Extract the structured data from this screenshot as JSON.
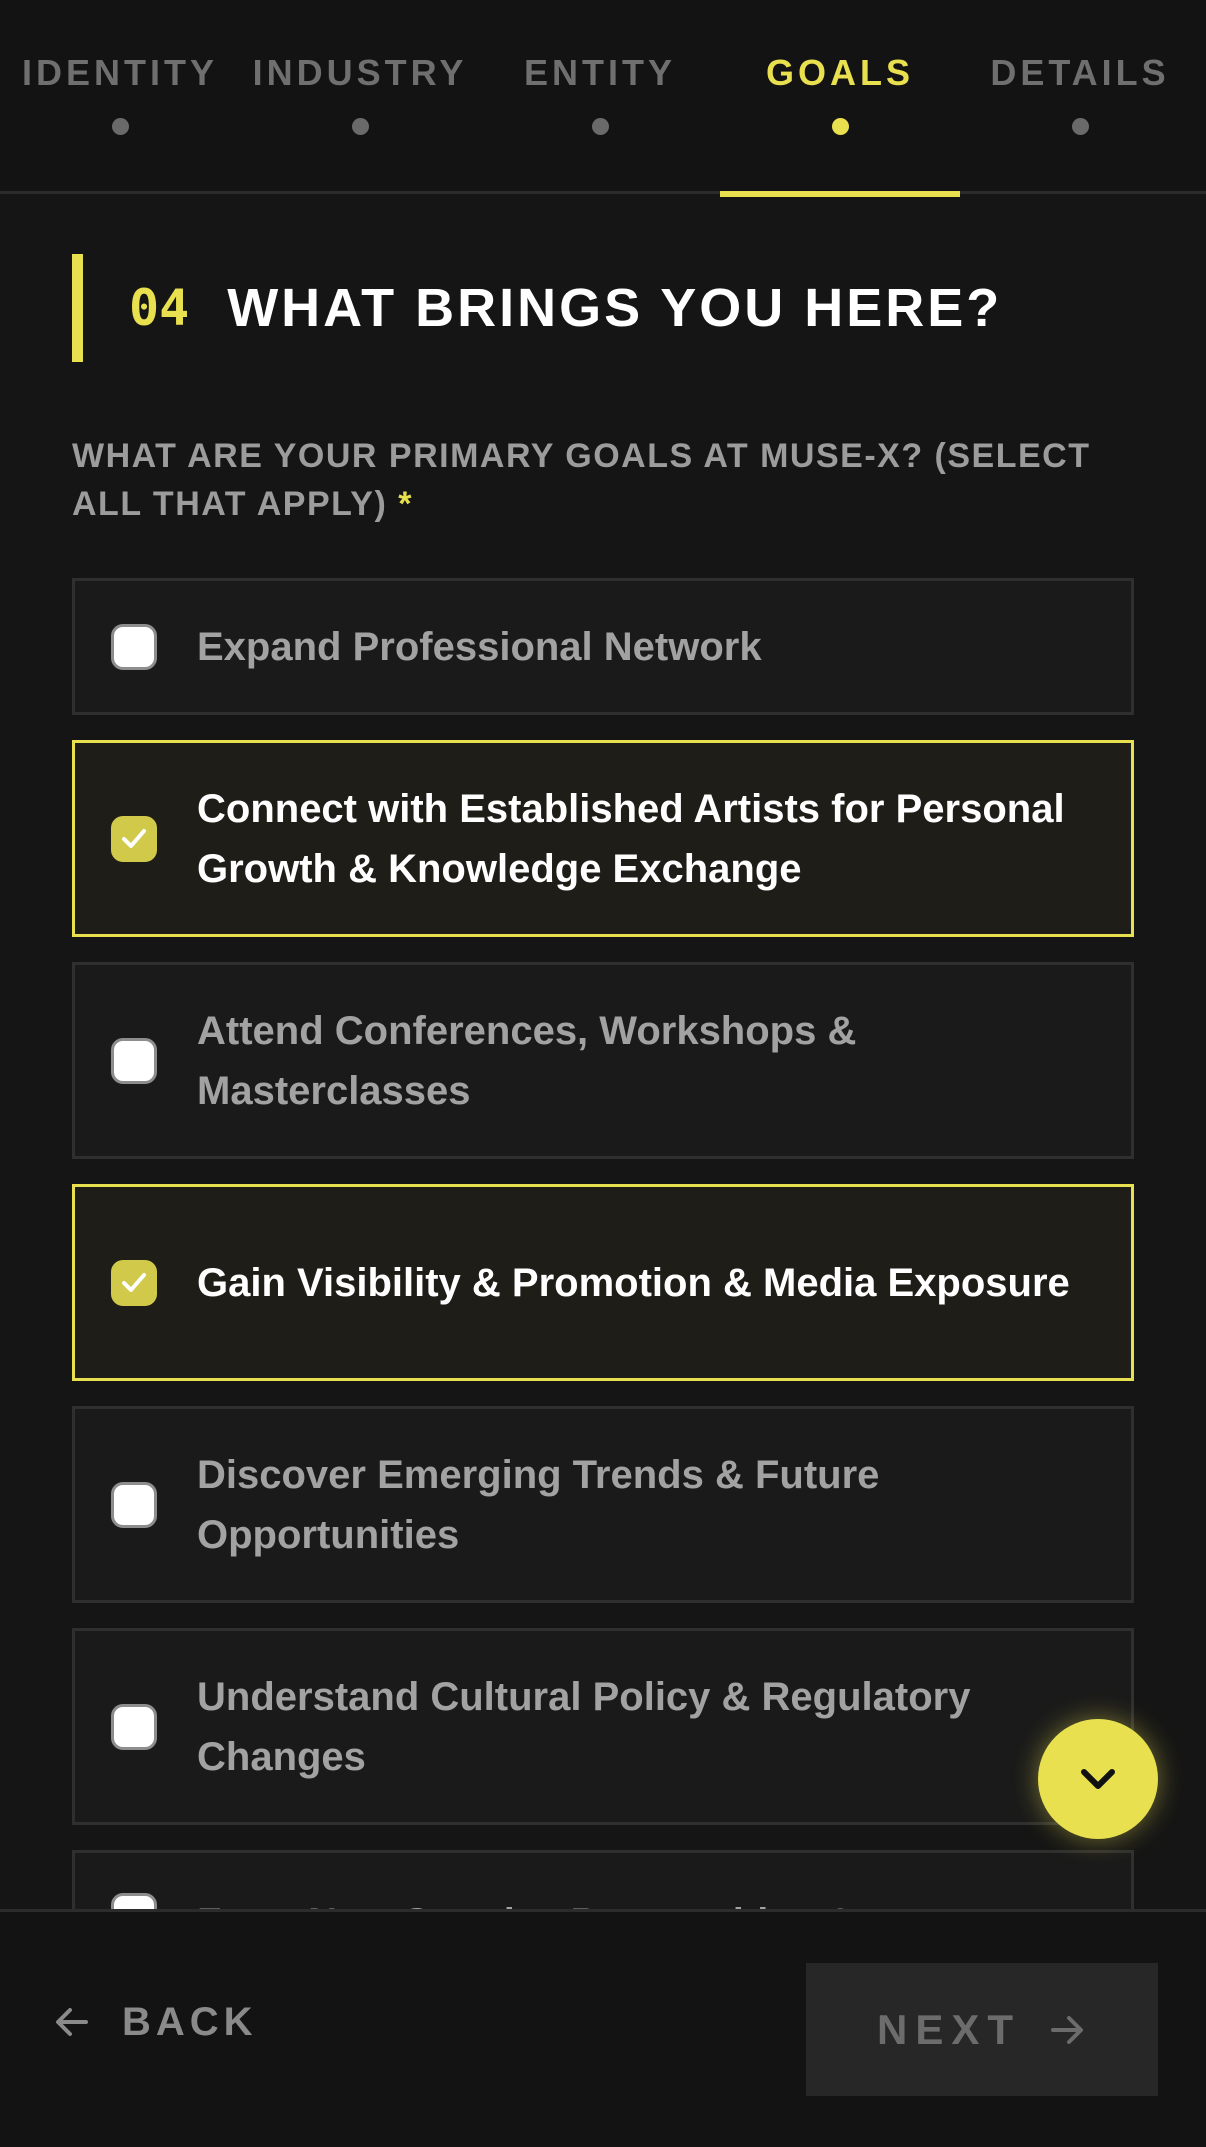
{
  "stepper": {
    "steps": [
      {
        "label": "IDENTITY"
      },
      {
        "label": "INDUSTRY"
      },
      {
        "label": "ENTITY"
      },
      {
        "label": "GOALS"
      },
      {
        "label": "DETAILS"
      }
    ],
    "active_index": 3,
    "accent_color": "#e8e04e"
  },
  "section": {
    "number": "04",
    "title": "WHAT BRINGS YOU HERE?"
  },
  "question": {
    "text": "WHAT ARE YOUR PRIMARY GOALS AT MUSE-X? (SELECT ALL THAT APPLY)",
    "required_marker": "*"
  },
  "options": [
    {
      "label": "Expand Professional Network",
      "checked": false
    },
    {
      "label": "Connect with Established Artists for Personal Growth & Knowledge Exchange",
      "checked": true
    },
    {
      "label": "Attend Conferences, Workshops & Masterclasses",
      "checked": false
    },
    {
      "label": "Gain Visibility & Promotion & Media Exposure",
      "checked": true
    },
    {
      "label": "Discover Emerging Trends & Future Opportunities",
      "checked": false
    },
    {
      "label": "Understand Cultural Policy & Regulatory Changes",
      "checked": false
    },
    {
      "label": "Form New Creative Partnerships &",
      "checked": false
    }
  ],
  "scroll_button": {
    "icon": "chevron-down-icon"
  },
  "footer": {
    "back_label": "BACK",
    "back_icon": "arrow-left-icon",
    "next_label": "NEXT",
    "next_icon": "arrow-right-icon"
  }
}
